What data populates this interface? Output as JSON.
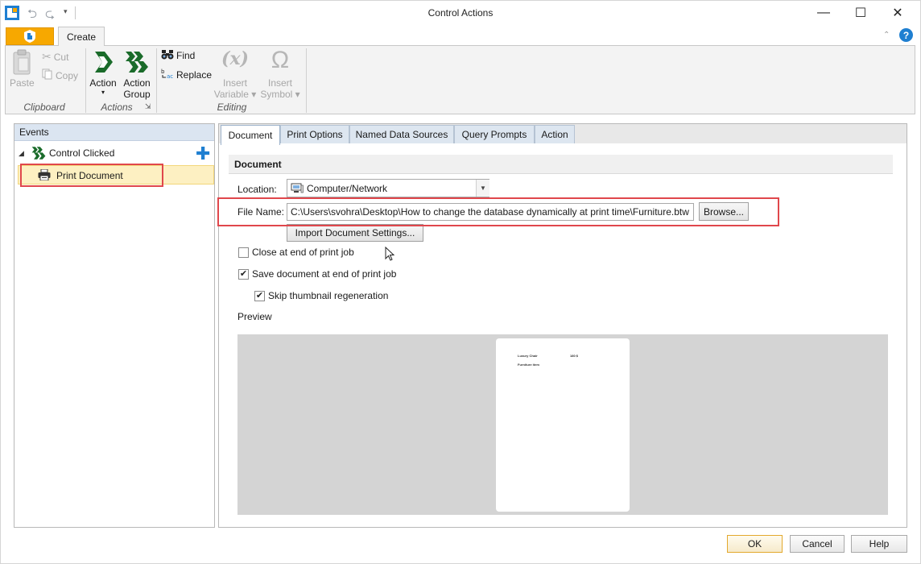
{
  "window": {
    "title": "Control Actions",
    "minimize_glyph": "—",
    "maximize_glyph": "☐",
    "close_glyph": "✕"
  },
  "quick_access": {
    "undo_glyph": "⮌",
    "redo_glyph": "⮎",
    "more_glyph": "▾"
  },
  "ribbon": {
    "tabs": [
      {
        "label": "Create"
      }
    ],
    "help_glyph": "?",
    "collapse_glyph": "⌃",
    "clipboard": {
      "paste_label": "Paste",
      "cut_label": "Cut",
      "copy_label": "Copy",
      "group_label": "Clipboard"
    },
    "actions": {
      "action_label": "Action",
      "action_caret": "▾",
      "action_group_label_line1": "Action",
      "action_group_label_line2": "Group",
      "group_label": "Actions",
      "launcher_glyph": "⇲"
    },
    "editing": {
      "find_label": "Find",
      "replace_label": "Replace",
      "insert_variable_glyph": "(x)",
      "insert_variable_line1": "Insert",
      "insert_variable_line2": "Variable ▾",
      "insert_symbol_glyph": "Ω",
      "insert_symbol_line1": "Insert",
      "insert_symbol_line2": "Symbol ▾",
      "group_label": "Editing"
    }
  },
  "events": {
    "header": "Events",
    "items": [
      {
        "label": "Control Clicked",
        "expanded": true
      },
      {
        "label": "Print Document",
        "selected": true
      }
    ],
    "expand_glyph": "◢",
    "add_glyph": "✚"
  },
  "detail": {
    "tabs": [
      {
        "label": "Document",
        "active": true
      },
      {
        "label": "Print Options"
      },
      {
        "label": "Named Data Sources"
      },
      {
        "label": "Query Prompts"
      },
      {
        "label": "Action"
      }
    ],
    "section_title": "Document",
    "location_label": "Location:",
    "location_value": "Computer/Network",
    "location_dropdown_glyph": "▼",
    "file_name_label": "File Name:",
    "file_name_value": "C:\\Users\\svohra\\Desktop\\How to change the database dynamically at print time\\Furniture.btw",
    "browse_label": "Browse...",
    "import_settings_label": "Import Document Settings...",
    "checkboxes": [
      {
        "label": "Close at end of print job",
        "checked": false
      },
      {
        "label": "Save document at end of print job",
        "checked": true
      },
      {
        "label": "Skip thumbnail regeneration",
        "checked": true
      }
    ],
    "check_glyph": "✔",
    "preview_label": "Preview",
    "preview_page_text": [
      "Luxury Chair",
      "180 $",
      "Furniture item"
    ]
  },
  "dialog_buttons": {
    "ok": "OK",
    "cancel": "Cancel",
    "help": "Help"
  },
  "colors": {
    "accent_orange": "#f7a800",
    "highlight_red": "#e0474c",
    "action_green": "#1a6b2a",
    "help_blue": "#1f7fd1",
    "selection_yellow": "#fdf0c2"
  }
}
